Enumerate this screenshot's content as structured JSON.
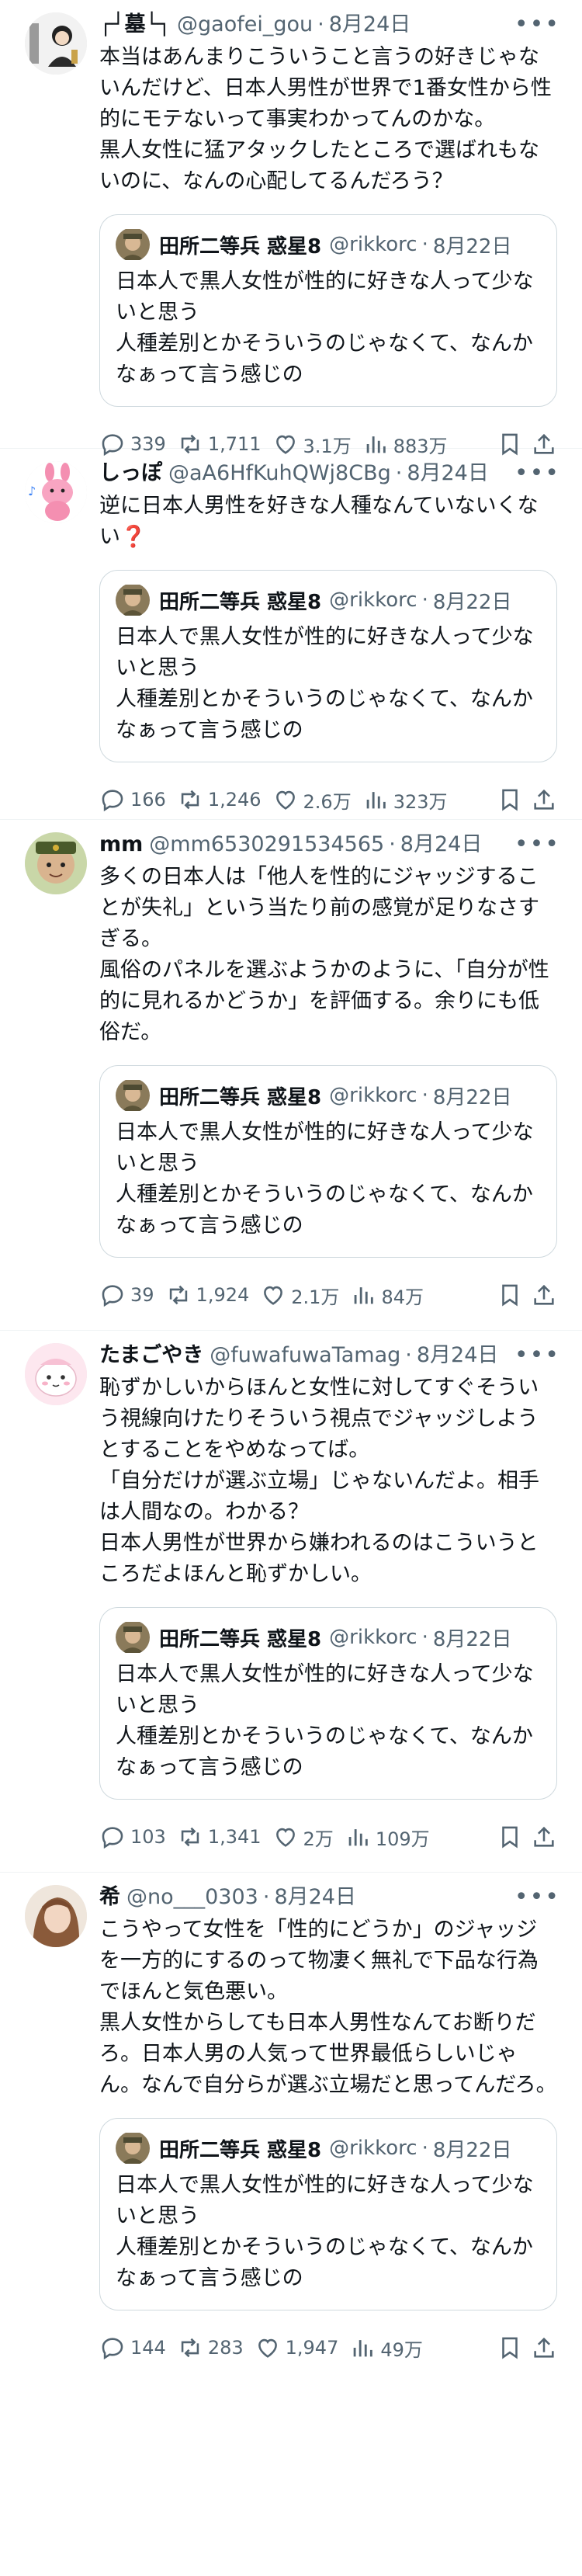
{
  "tweets": [
    {
      "name": "┌┘墓└┐",
      "handle": "@gaofei_gou",
      "date": "8月24日",
      "text": "本当はあんまりこういうこと言うの好きじゃないんだけど、日本人男性が世界で1番女性から性的にモテないって事実わかってんのかな。\n黒人女性に猛アタックしたところで選ばれもないのに、なんの心配してるんだろう？",
      "quote": {
        "name": "田所二等兵 惑星8",
        "handle": "@rikkorc",
        "date": "8月22日",
        "text": "日本人で黒人女性が性的に好きな人って少ないと思う\n人種差別とかそういうのじゃなくて、なんかなぁって言う感じの"
      },
      "stats": {
        "replies": "339",
        "retweets": "1,711",
        "likes": "3.1万",
        "views": "883万"
      }
    },
    {
      "name": "しっぽ",
      "handle": "@aA6HfKuhQWj8CBg",
      "date": "8月24日",
      "text": "逆に日本人男性を好きな人種なんていないくない❓",
      "quote": {
        "name": "田所二等兵 惑星8",
        "handle": "@rikkorc",
        "date": "8月22日",
        "text": "日本人で黒人女性が性的に好きな人って少ないと思う\n人種差別とかそういうのじゃなくて、なんかなぁって言う感じの"
      },
      "stats": {
        "replies": "166",
        "retweets": "1,246",
        "likes": "2.6万",
        "views": "323万"
      }
    },
    {
      "name": "mm",
      "handle": "@mm6530291534565",
      "date": "8月24日",
      "text": "多くの日本人は「他人を性的にジャッジすることが失礼」という当たり前の感覚が足りなさすぎる。\n風俗のパネルを選ぶようかのように、「自分が性的に見れるかどうか」を評価する。余りにも低俗だ。",
      "quote": {
        "name": "田所二等兵 惑星8",
        "handle": "@rikkorc",
        "date": "8月22日",
        "text": "日本人で黒人女性が性的に好きな人って少ないと思う\n人種差別とかそういうのじゃなくて、なんかなぁって言う感じの"
      },
      "stats": {
        "replies": "39",
        "retweets": "1,924",
        "likes": "2.1万",
        "views": "84万"
      }
    },
    {
      "name": "たまごやき",
      "handle": "@fuwafuwaTamag",
      "date": "8月24日",
      "text": "恥ずかしいからほんと女性に対してすぐそういう視線向けたりそういう視点でジャッジしようとすることをやめなってば。\n「自分だけが選ぶ立場」じゃないんだよ。相手は人間なの。わかる？\n日本人男性が世界から嫌われるのはこういうところだよほんと恥ずかしい。",
      "quote": {
        "name": "田所二等兵 惑星8",
        "handle": "@rikkorc",
        "date": "8月22日",
        "text": "日本人で黒人女性が性的に好きな人って少ないと思う\n人種差別とかそういうのじゃなくて、なんかなぁって言う感じの"
      },
      "stats": {
        "replies": "103",
        "retweets": "1,341",
        "likes": "2万",
        "views": "109万"
      }
    },
    {
      "name": "希",
      "handle": "@no___0303",
      "date": "8月24日",
      "text": "こうやって女性を「性的にどうか」のジャッジを一方的にするのって物凄く無礼で下品な行為でほんと気色悪い。\n黒人女性からしても日本人男性なんてお断りだろ。日本人男の人気って世界最低らしいじゃん。なんで自分らが選ぶ立場だと思ってんだろ。",
      "quote": {
        "name": "田所二等兵 惑星8",
        "handle": "@rikkorc",
        "date": "8月22日",
        "text": "日本人で黒人女性が性的に好きな人って少ないと思う\n人種差別とかそういうのじゃなくて、なんかなぁって言う感じの"
      },
      "stats": {
        "replies": "144",
        "retweets": "283",
        "likes": "1,947",
        "views": "49万"
      }
    }
  ],
  "ui": {
    "more_glyph": "•••",
    "dot": "·"
  },
  "icons": [
    "reply-icon",
    "retweet-icon",
    "like-icon",
    "views-icon",
    "bookmark-icon",
    "share-icon",
    "more-icon"
  ],
  "colors": {
    "text": "#0f1419",
    "secondary": "#536471",
    "border": "#cfd9de",
    "divider": "#eff3f4"
  }
}
